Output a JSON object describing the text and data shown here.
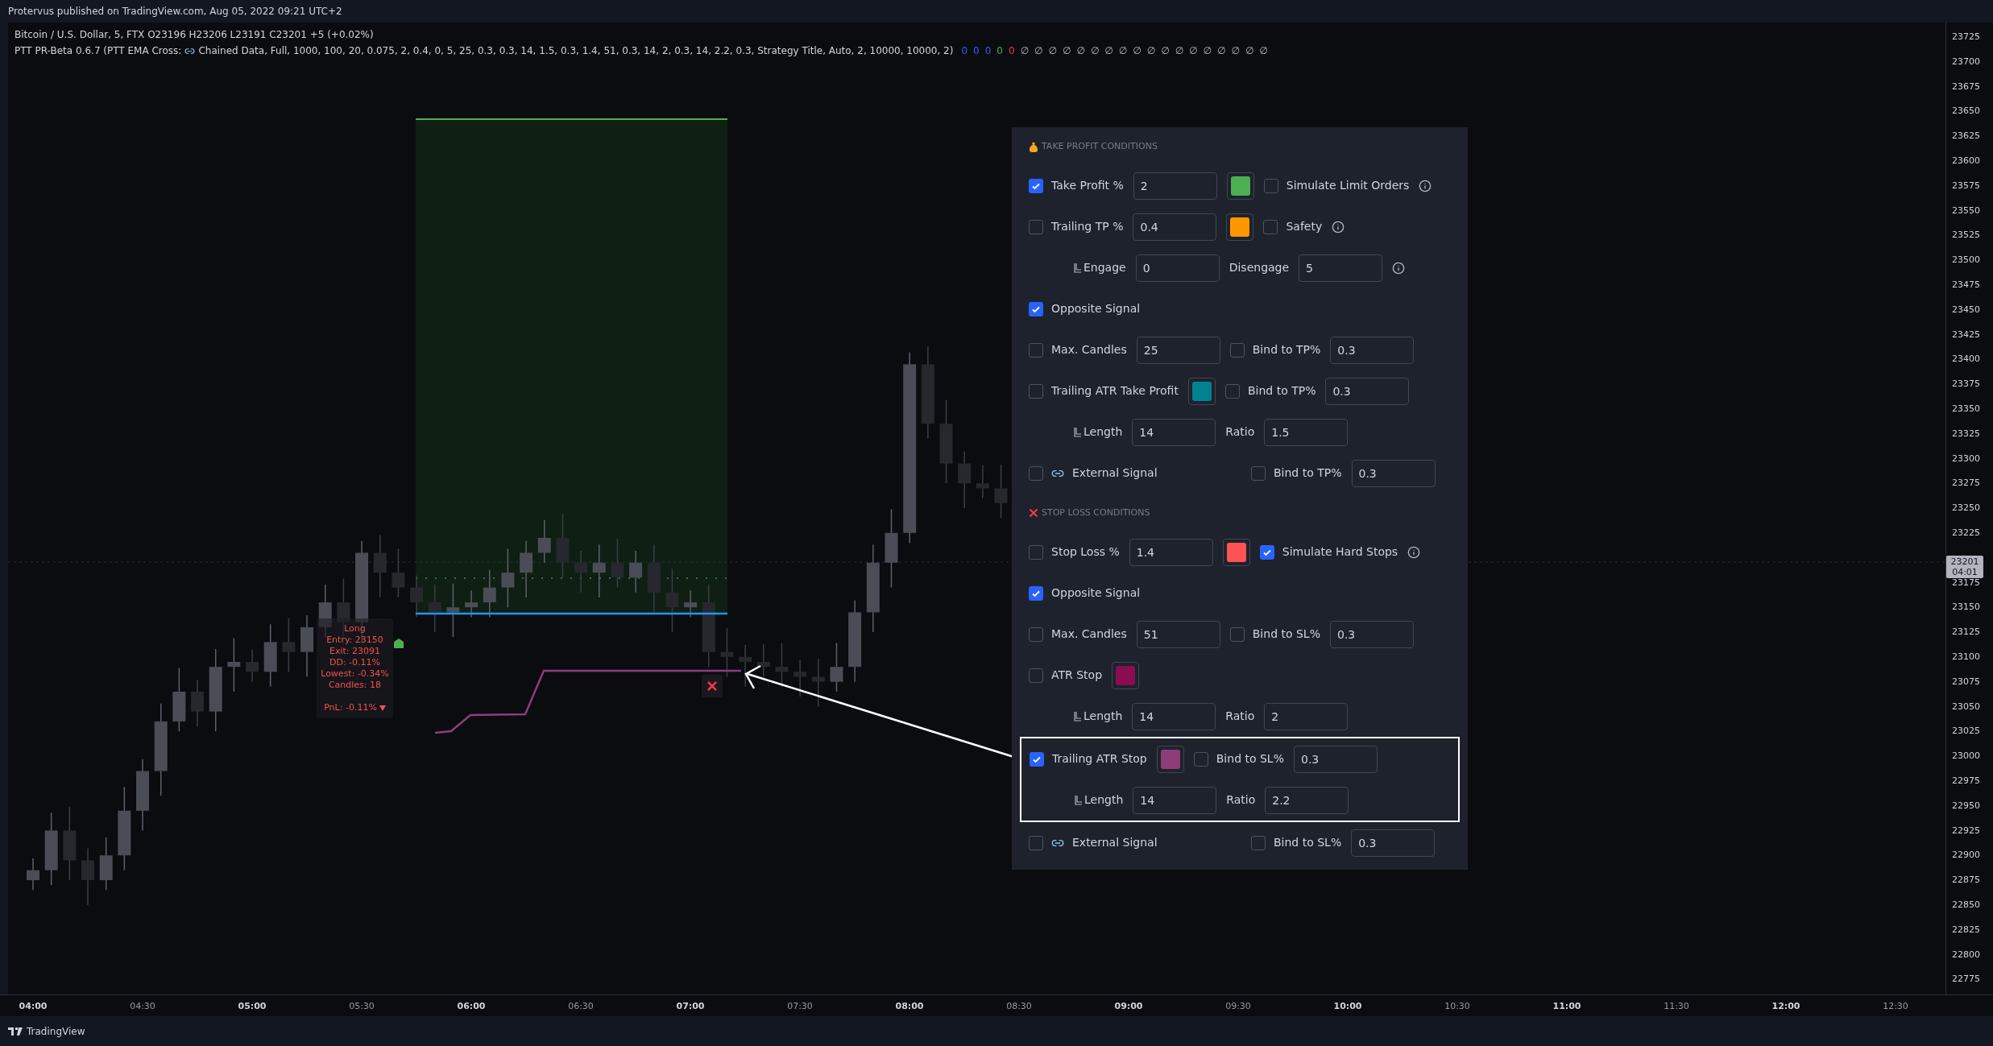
{
  "header": {
    "publisher_line": "Protervus published on TradingView.com, Aug 05, 2022 09:21 UTC+2"
  },
  "legend": {
    "symbol_line": "Bitcoin / U.S. Dollar, 5, FTX  O23196  H23206  L23191  C23201  +5 (+0.02%)",
    "indicator_prefix": "PTT PR-Beta 0.6.7 (PTT EMA Cross:",
    "indicator_params": "Chained Data, Full, 1000, 100, 20, 0.075, 2, 0.4, 0, 5, 25, 0.3, 0.3, 14, 1.5, 0.3, 1.4, 51, 0.3, 14, 2, 0.3, 14, 2.2, 0.3, Strategy Title, Auto, 2, 10000, 10000, 2)",
    "plot_values": [
      {
        "text": "0",
        "color": "#2962ff"
      },
      {
        "text": "0",
        "color": "#2962ff"
      },
      {
        "text": "0",
        "color": "#2962ff"
      },
      {
        "text": "0",
        "color": "#4caf50"
      },
      {
        "text": "0",
        "color": "#f23645"
      },
      {
        "text": "∅"
      },
      {
        "text": "∅"
      },
      {
        "text": "∅"
      },
      {
        "text": "∅"
      },
      {
        "text": "∅"
      },
      {
        "text": "∅"
      },
      {
        "text": "∅"
      },
      {
        "text": "∅"
      },
      {
        "text": "∅"
      },
      {
        "text": "∅"
      },
      {
        "text": "∅"
      },
      {
        "text": "∅"
      },
      {
        "text": "∅"
      },
      {
        "text": "∅"
      },
      {
        "text": "∅"
      },
      {
        "text": "∅"
      },
      {
        "text": "∅"
      },
      {
        "text": "∅"
      }
    ]
  },
  "trade_label": {
    "lines": [
      "Long",
      "Entry: 23150",
      "Exit: 23091",
      "DD: -0.11%",
      "Lowest: -0.34%",
      "Candles: 18"
    ],
    "pnl": "PnL: -0.11%"
  },
  "settings_panel": {
    "sections": [
      {
        "kind": "take_profit",
        "title": "TAKE PROFIT CONDITIONS",
        "rows": [
          {
            "kind": "row",
            "items": [
              {
                "kind": "checkbox",
                "label": "Take Profit %",
                "checked": true
              },
              {
                "kind": "input",
                "value": "2"
              },
              {
                "kind": "swatch",
                "color": "#4caf50"
              },
              {
                "kind": "checkbox",
                "label": "Simulate Limit Orders",
                "checked": false
              },
              {
                "kind": "info"
              }
            ]
          },
          {
            "kind": "row",
            "items": [
              {
                "kind": "checkbox",
                "label": "Trailing TP %",
                "checked": false
              },
              {
                "kind": "input",
                "value": "0.4"
              },
              {
                "kind": "swatch",
                "color": "#ff9800"
              },
              {
                "kind": "checkbox",
                "label": "Safety",
                "checked": false
              },
              {
                "kind": "info"
              }
            ]
          },
          {
            "kind": "row",
            "items": [
              {
                "kind": "sublabel",
                "label": "Engage"
              },
              {
                "kind": "input",
                "value": "0"
              },
              {
                "kind": "label",
                "label": "Disengage"
              },
              {
                "kind": "input",
                "value": "5"
              },
              {
                "kind": "info"
              }
            ]
          },
          {
            "kind": "row",
            "items": [
              {
                "kind": "checkbox",
                "label": "Opposite Signal",
                "checked": true
              }
            ]
          },
          {
            "kind": "row",
            "items": [
              {
                "kind": "checkbox",
                "label": "Max. Candles",
                "checked": false
              },
              {
                "kind": "input",
                "value": "25"
              },
              {
                "kind": "checkbox",
                "label": "Bind to TP%",
                "checked": false
              },
              {
                "kind": "input",
                "value": "0.3"
              }
            ]
          },
          {
            "kind": "row",
            "items": [
              {
                "kind": "checkbox",
                "label": "Trailing ATR Take Profit",
                "checked": false
              },
              {
                "kind": "swatch",
                "color": "#00838f"
              },
              {
                "kind": "checkbox",
                "label": "Bind to TP%",
                "checked": false
              },
              {
                "kind": "input",
                "value": "0.3"
              }
            ]
          },
          {
            "kind": "row",
            "items": [
              {
                "kind": "sublabel",
                "label": "Length"
              },
              {
                "kind": "input",
                "value": "14"
              },
              {
                "kind": "label",
                "label": "Ratio"
              },
              {
                "kind": "input",
                "value": "1.5"
              }
            ]
          },
          {
            "kind": "row",
            "items": [
              {
                "kind": "linkcheckbox",
                "label": "External Signal",
                "checked": false
              },
              {
                "kind": "checkbox",
                "label": "Bind to TP%",
                "checked": false
              },
              {
                "kind": "input",
                "value": "0.3"
              }
            ]
          }
        ]
      },
      {
        "kind": "stop_loss",
        "title": "STOP LOSS CONDITIONS",
        "rows": [
          {
            "kind": "row",
            "items": [
              {
                "kind": "checkbox",
                "label": "Stop Loss %",
                "checked": false
              },
              {
                "kind": "input",
                "value": "1.4"
              },
              {
                "kind": "swatch",
                "color": "#ff5252"
              },
              {
                "kind": "checkbox",
                "label": "Simulate Hard Stops",
                "checked": true
              },
              {
                "kind": "info"
              }
            ]
          },
          {
            "kind": "row",
            "items": [
              {
                "kind": "checkbox",
                "label": "Opposite Signal",
                "checked": true
              }
            ]
          },
          {
            "kind": "row",
            "items": [
              {
                "kind": "checkbox",
                "label": "Max. Candles",
                "checked": false
              },
              {
                "kind": "input",
                "value": "51"
              },
              {
                "kind": "checkbox",
                "label": "Bind to SL%",
                "checked": false
              },
              {
                "kind": "input",
                "value": "0.3"
              }
            ]
          },
          {
            "kind": "row",
            "items": [
              {
                "kind": "checkbox",
                "label": "ATR Stop",
                "checked": false
              },
              {
                "kind": "swatch",
                "color": "#880e4f"
              }
            ]
          },
          {
            "kind": "row",
            "items": [
              {
                "kind": "sublabel",
                "label": "Length"
              },
              {
                "kind": "input",
                "value": "14"
              },
              {
                "kind": "label",
                "label": "Ratio"
              },
              {
                "kind": "input",
                "value": "2"
              }
            ]
          },
          {
            "kind": "group",
            "highlighted": true,
            "rows": [
              {
                "kind": "row",
                "items": [
                  {
                    "kind": "checkbox",
                    "label": "Trailing ATR Stop",
                    "checked": true
                  },
                  {
                    "kind": "swatch",
                    "color": "#8e3c7a"
                  },
                  {
                    "kind": "checkbox",
                    "label": "Bind to SL%",
                    "checked": false
                  },
                  {
                    "kind": "input",
                    "value": "0.3"
                  }
                ]
              },
              {
                "kind": "row",
                "items": [
                  {
                    "kind": "sublabel",
                    "label": "Length"
                  },
                  {
                    "kind": "input",
                    "value": "14"
                  },
                  {
                    "kind": "label",
                    "label": "Ratio"
                  },
                  {
                    "kind": "input",
                    "value": "2.2"
                  }
                ]
              }
            ]
          },
          {
            "kind": "row",
            "items": [
              {
                "kind": "linkcheckbox",
                "label": "External Signal",
                "checked": false
              },
              {
                "kind": "checkbox",
                "label": "Bind to SL%",
                "checked": false
              },
              {
                "kind": "input",
                "value": "0.3"
              }
            ]
          }
        ]
      }
    ]
  },
  "price_axis": {
    "ticks": [
      "23725",
      "23700",
      "23675",
      "23650",
      "23625",
      "23600",
      "23575",
      "23550",
      "23525",
      "23500",
      "23475",
      "23450",
      "23425",
      "23400",
      "23375",
      "23350",
      "23325",
      "23300",
      "23275",
      "23250",
      "23225",
      "23175",
      "23150",
      "23125",
      "23100",
      "23075",
      "23050",
      "23025",
      "23000",
      "22975",
      "22950",
      "22925",
      "22900",
      "22875",
      "22850",
      "22825",
      "22800",
      "22775"
    ],
    "current_price": "23201",
    "countdown": "04:01"
  },
  "time_axis": {
    "ticks": [
      {
        "label": "04:00",
        "major": true
      },
      {
        "label": "04:30",
        "major": false
      },
      {
        "label": "05:00",
        "major": true
      },
      {
        "label": "05:30",
        "major": false
      },
      {
        "label": "06:00",
        "major": true
      },
      {
        "label": "06:30",
        "major": false
      },
      {
        "label": "07:00",
        "major": true
      },
      {
        "label": "07:30",
        "major": false
      },
      {
        "label": "08:00",
        "major": true
      },
      {
        "label": "08:30",
        "major": false
      },
      {
        "label": "09:00",
        "major": true
      },
      {
        "label": "09:30",
        "major": false
      },
      {
        "label": "10:00",
        "major": true
      },
      {
        "label": "10:30",
        "major": false
      },
      {
        "label": "11:00",
        "major": true
      },
      {
        "label": "11:30",
        "major": false
      },
      {
        "label": "12:00",
        "major": true
      },
      {
        "label": "12:30",
        "major": false
      }
    ]
  },
  "footer": {
    "brand": "TradingView"
  }
}
